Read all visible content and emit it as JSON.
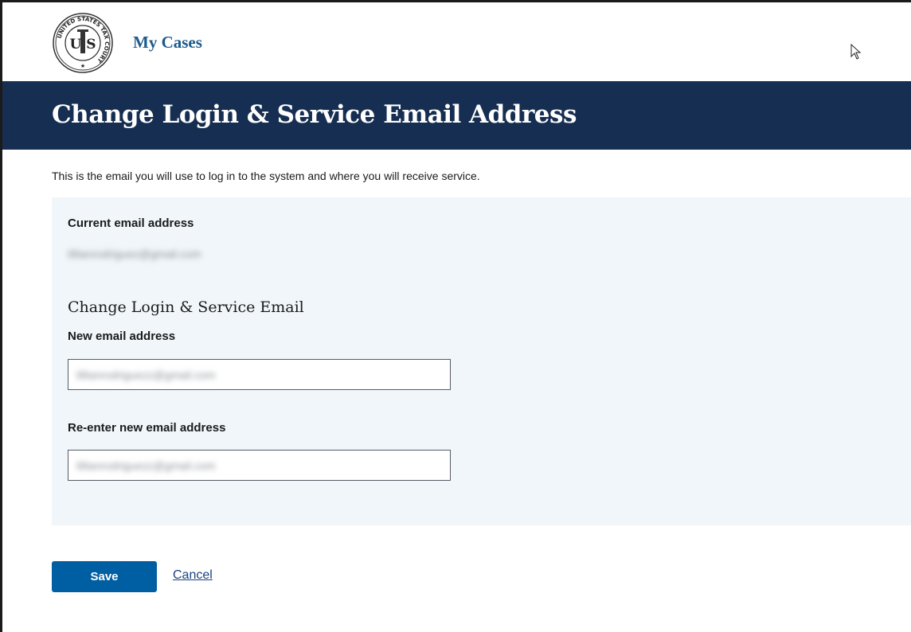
{
  "header": {
    "brand": "My Cases",
    "seal": {
      "ring_text": "UNITED STATES TAX COURT",
      "center_text": "U S"
    }
  },
  "banner": {
    "title": "Change Login & Service Email Address"
  },
  "intro_text": "This is the email you will use to log in to the system and where you will receive service.",
  "form": {
    "current_label": "Current email address",
    "current_value": "lillianrodriguez@gmail.com",
    "section_heading": "Change Login & Service Email",
    "new_label": "New email address",
    "new_value": "lillianrodriguezz@gmail.com",
    "reenter_label": "Re-enter new email address",
    "reenter_value": "lillianrodriguezz@gmail.com"
  },
  "actions": {
    "save_label": "Save",
    "cancel_label": "Cancel"
  },
  "colors": {
    "banner": "#162e51",
    "brand": "#1c5a8c",
    "panel": "#f0f6f9",
    "primary": "#005ea2",
    "link": "#1a4480"
  }
}
